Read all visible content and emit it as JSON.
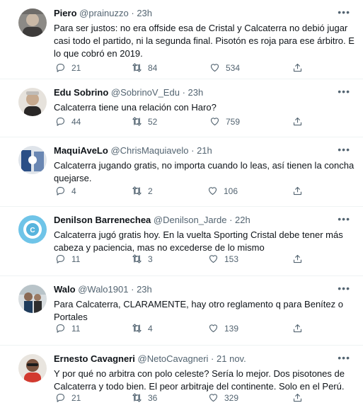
{
  "tweets": [
    {
      "name": "Piero",
      "handle": "@prainuzzo",
      "time": "23h",
      "lines": [
        "Para ser justos: no era offside esa de Cristal y Calcaterra no debió jugar",
        "casi todo el partido, ni la segunda final. Pisotón es roja para ese árbitro. Es",
        "lo que cobró en 2019."
      ],
      "replies": "21",
      "retweets": "84",
      "likes": "534"
    },
    {
      "name": "Edu Sobrino",
      "handle": "@SobrinoV_Edu",
      "time": "23h",
      "lines": [
        "Calcaterra tiene una relación con Haro?"
      ],
      "replies": "44",
      "retweets": "52",
      "likes": "759"
    },
    {
      "name": "MaquiAveLo",
      "handle": "@ChrisMaquiavelo",
      "time": "21h",
      "lines": [
        "Calcaterra jugando gratis, no importa cuando lo leas, así tienen la concha d",
        "quejarse."
      ],
      "replies": "4",
      "retweets": "2",
      "likes": "106"
    },
    {
      "name": "Denilson Barrenechea",
      "handle": "@Denilson_Jarde",
      "time": "22h",
      "lines": [
        "Calcaterra jugó gratis hoy. En la vuelta Sporting Cristal debe tener más",
        "cabeza y paciencia, mas no excederse de lo mismo"
      ],
      "replies": "11",
      "retweets": "3",
      "likes": "153"
    },
    {
      "name": "Walo",
      "handle": "@Walo1901",
      "time": "23h",
      "lines": [
        "Para Calcaterra, CLARAMENTE, hay otro reglamento q para Benítez o",
        "Portales"
      ],
      "replies": "11",
      "retweets": "4",
      "likes": "139"
    },
    {
      "name": "Ernesto Cavagneri",
      "handle": "@NetoCavagneri",
      "time": "21 nov.",
      "lines": [
        "Y por qué no arbitra con polo celeste? Sería lo mejor. Dos pisotones de",
        "Calcaterra y todo bien. El peor arbitraje del continente. Solo en el Perú."
      ],
      "replies": "21",
      "retweets": "36",
      "likes": "329"
    }
  ],
  "icons": {
    "reply": "reply-icon",
    "retweet": "retweet-icon",
    "like": "heart-icon",
    "share": "share-icon",
    "more": "more-icon"
  },
  "colors": {
    "text": "#0f1419",
    "secondary": "#536471",
    "divider": "#eff3f4"
  }
}
